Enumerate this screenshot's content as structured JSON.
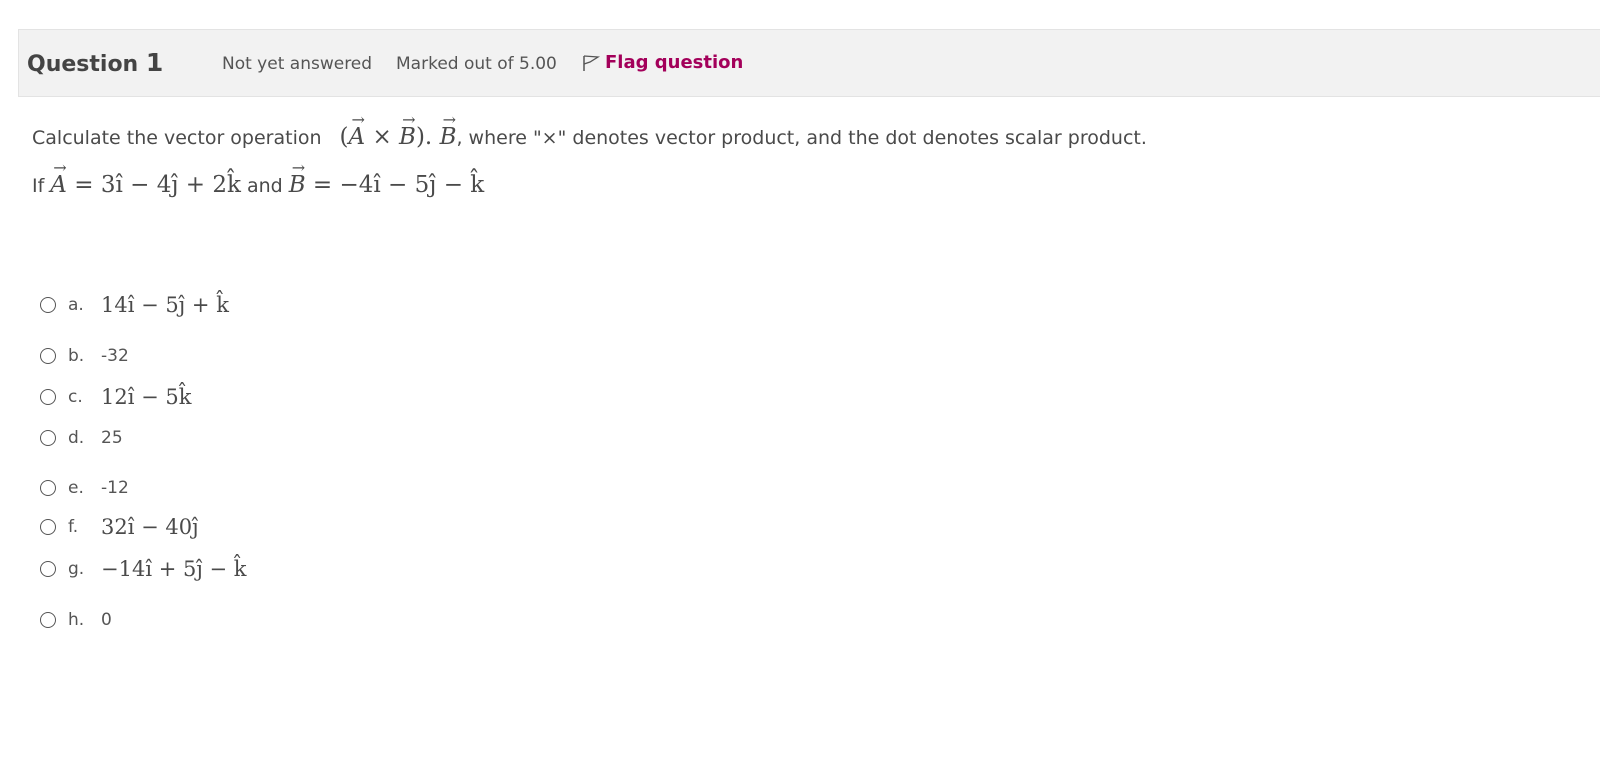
{
  "header": {
    "question_word": "Question",
    "question_number": "1",
    "state": "Not yet answered",
    "grade": "Marked out of 5.00",
    "flag_label": "Flag question"
  },
  "question": {
    "intro": "Calculate the vector operation",
    "expression": "(A × B). B",
    "suffix": ", where \"×\" denotes vector product, and the dot denotes scalar product.",
    "if_word": "If",
    "vector_a_name": "A",
    "vector_a_value": "= 3î − 4ĵ + 2k̂",
    "and_word": "and",
    "vector_b_name": "B",
    "vector_b_value": "= −4î − 5ĵ − k̂"
  },
  "options": [
    {
      "letter": "a.",
      "value": "14î − 5ĵ + k̂"
    },
    {
      "letter": "b.",
      "value": "-32"
    },
    {
      "letter": "c.",
      "value": "12î − 5k̂"
    },
    {
      "letter": "d.",
      "value": "25"
    },
    {
      "letter": "e.",
      "value": "-12"
    },
    {
      "letter": "f.",
      "value": "32î − 40ĵ"
    },
    {
      "letter": "g.",
      "value": "−14î + 5ĵ − k̂"
    },
    {
      "letter": "h.",
      "value": "0"
    }
  ],
  "colors": {
    "flag_color": "#a3005a",
    "info_bar_bg": "#f2f2f2"
  },
  "icons": {
    "flag": "flag-outline-icon",
    "radio": "radio-unchecked-icon"
  }
}
